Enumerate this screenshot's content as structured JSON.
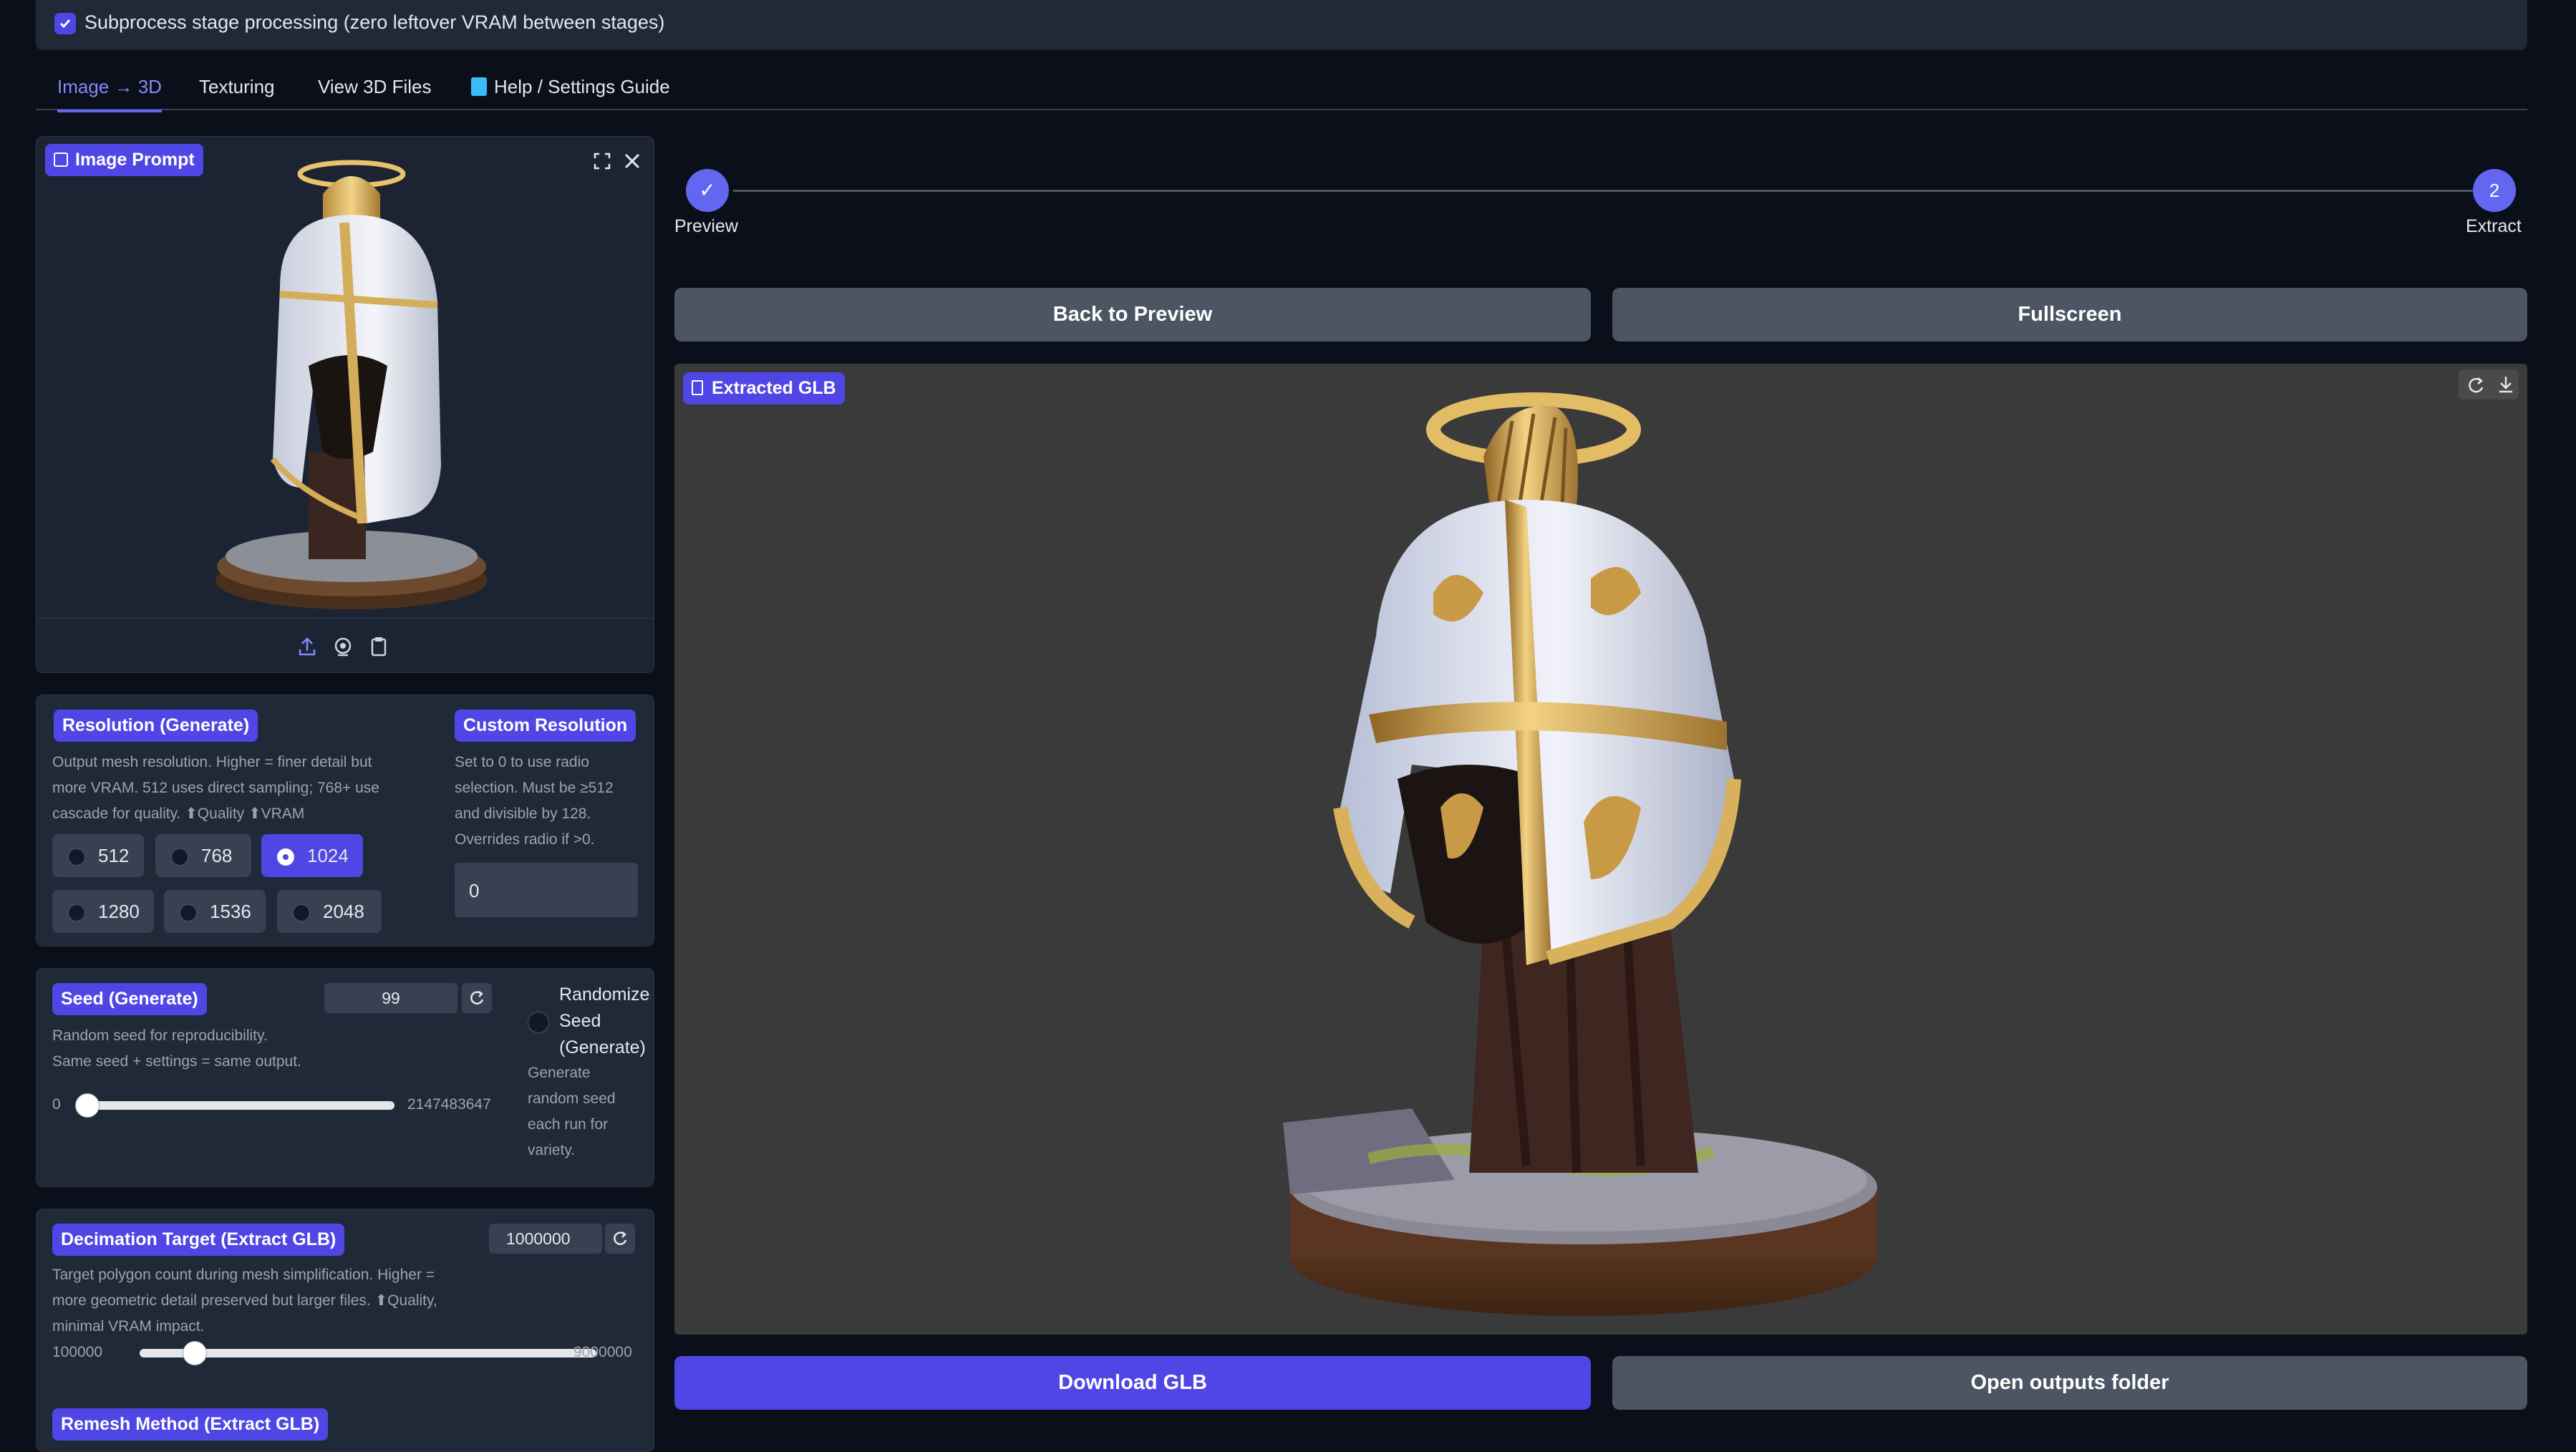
{
  "subprocess": {
    "label": "Subprocess stage processing (zero leftover VRAM between stages)",
    "checked": true
  },
  "tabs": [
    {
      "label": "Image → 3D",
      "active": true
    },
    {
      "label": "Texturing",
      "active": false
    },
    {
      "label": "View 3D Files",
      "active": false
    },
    {
      "label": "Help / Settings Guide",
      "active": false
    }
  ],
  "image_prompt": {
    "label": "Image Prompt"
  },
  "resolution": {
    "label": "Resolution (Generate)",
    "desc": [
      "Output mesh resolution. Higher = finer detail but",
      "more VRAM. 512 uses direct sampling; 768+ use",
      "cascade for quality. ⬆Quality ⬆VRAM"
    ],
    "options": [
      "512",
      "768",
      "1024",
      "1280",
      "1536",
      "2048"
    ],
    "selected": "1024"
  },
  "custom_resolution": {
    "label": "Custom Resolution",
    "desc": [
      "Set to 0 to use radio",
      "selection. Must be ≥512",
      "and divisible by 128.",
      "Overrides radio if >0."
    ],
    "value": "0"
  },
  "seed": {
    "label": "Seed (Generate)",
    "value": "99",
    "desc": [
      "Random seed for reproducibility.",
      "Same seed + settings = same output."
    ],
    "min": "0",
    "max": "2147483647",
    "fraction": 0.0
  },
  "randomize": {
    "label": [
      "Randomize",
      "Seed",
      "(Generate)"
    ],
    "desc": [
      "Generate",
      "random seed",
      "each run for",
      "variety."
    ]
  },
  "decimation": {
    "label": "Decimation Target (Extract GLB)",
    "value": "1000000",
    "desc": [
      "Target polygon count during mesh simplification. Higher =",
      "more geometric detail preserved but larger files. ⬆Quality,",
      "minimal VRAM impact."
    ],
    "min": "100000",
    "max": "9000000",
    "fraction": 0.1
  },
  "remesh": {
    "label": "Remesh Method (Extract GLB)"
  },
  "steps": [
    {
      "label": "Preview",
      "marker": "✓"
    },
    {
      "label": "Extract",
      "marker": "2"
    }
  ],
  "buttons": {
    "back": "Back to Preview",
    "fullscreen": "Fullscreen",
    "download": "Download GLB",
    "open_outputs": "Open outputs folder"
  },
  "viewer": {
    "label": "Extracted GLB"
  },
  "colors": {
    "accent": "#4f46e5",
    "panel": "#1f2937",
    "background": "#0b0f19"
  }
}
